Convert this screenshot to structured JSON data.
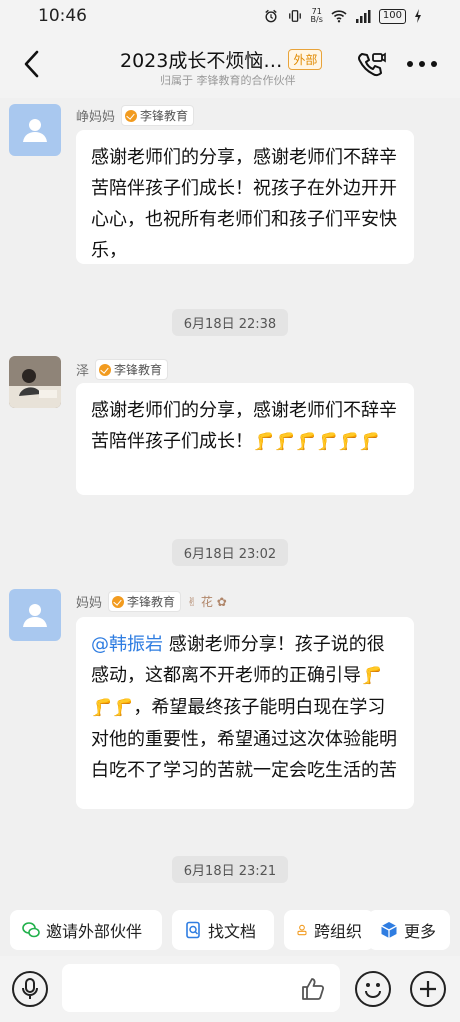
{
  "status": {
    "time": "10:46",
    "speed_top": "71",
    "speed_bottom": "B/s",
    "battery": "100"
  },
  "header": {
    "title": "2023成长不烦恼…",
    "badge": "外部",
    "subtitle": "归属于 李锋教育的合作伙伴",
    "icons": [
      "back-icon",
      "video-call-icon",
      "more-icon"
    ]
  },
  "messages": [
    {
      "sender": "峥妈妈",
      "org": "李锋教育",
      "extra": "",
      "text": "感谢老师们的分享，感谢老师们不辞辛苦陪伴孩子们成长！祝孩子在外边开开心心，也祝所有老师们和孩子们平安快乐，"
    },
    {
      "sender": "泽",
      "org": "李锋教育",
      "extra": "",
      "text": "感谢老师们的分享，感谢老师们不辞辛苦陪伴孩子们成长！",
      "emoji": "🦵🦵🦵🦵🦵🦵"
    },
    {
      "sender": "妈妈",
      "org": "李锋教育",
      "extra": "花",
      "mention": "@韩振岩",
      "text_a": "感谢老师分享！孩子说的很感动，这都离不开老师的正确引导",
      "emoji": "🦵🦵🦵",
      "text_b": "，希望最终孩子能明白现在学习对他的重要性，希望通过这次体验能明白吃不了学习的苦就一定会吃生活的苦"
    }
  ],
  "timestamps": [
    "6月18日 22:38",
    "6月18日 23:02",
    "6月18日 23:21"
  ],
  "quick_actions": [
    "邀请外部伙伴",
    "找文档",
    "跨组织",
    "更多"
  ],
  "colors": {
    "accent": "#2f7de1",
    "badge_orange": "#e08a00",
    "avatar_blue": "#a9c8ef"
  }
}
